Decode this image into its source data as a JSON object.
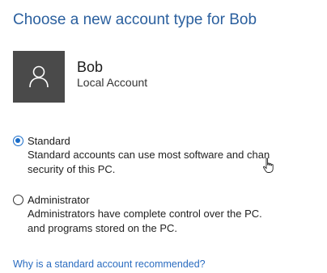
{
  "page": {
    "title": "Choose a new account type for Bob"
  },
  "user": {
    "name": "Bob",
    "account_type": "Local Account",
    "avatar_icon": "person-icon"
  },
  "options": [
    {
      "label": "Standard",
      "description_line1": "Standard accounts can use most software and chan",
      "description_line2": "security of this PC.",
      "selected": true
    },
    {
      "label": "Administrator",
      "description_line1": "Administrators have complete control over the PC.",
      "description_line2": "and programs stored on the PC.",
      "selected": false
    }
  ],
  "help_link": "Why is a standard account recommended?",
  "colors": {
    "title": "#2a5f9e",
    "link": "#2a6cc0",
    "avatar_bg": "#4a4a4a",
    "radio_selected": "#1a6dc9"
  }
}
